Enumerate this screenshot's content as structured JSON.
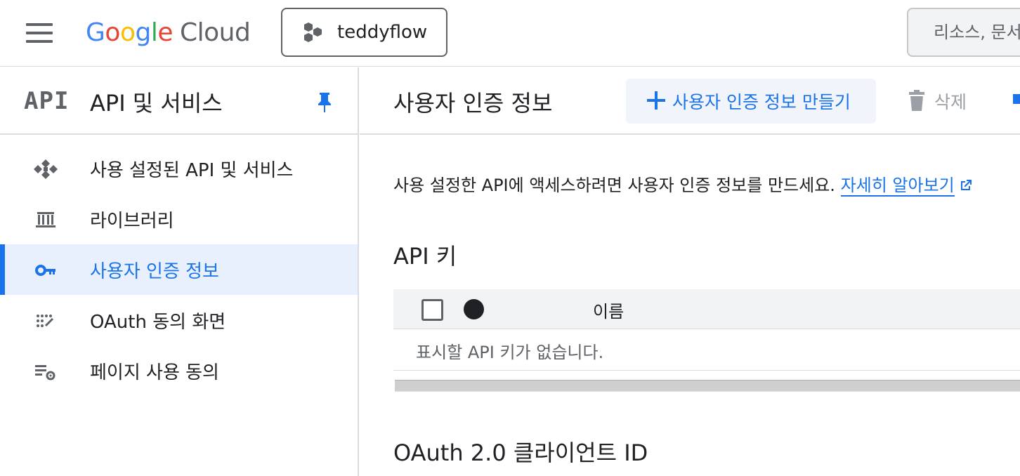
{
  "topbar": {
    "logo_google": [
      "G",
      "o",
      "o",
      "g",
      "l",
      "e"
    ],
    "logo_cloud": "Cloud",
    "project_name": "teddyflow",
    "search_placeholder": "리소스, 문서"
  },
  "sidebar": {
    "logo_text": "API",
    "title": "API 및 서비스",
    "items": [
      {
        "label": "사용 설정된 API 및 서비스",
        "icon": "api-diamond-icon",
        "active": false
      },
      {
        "label": "라이브러리",
        "icon": "library-icon",
        "active": false
      },
      {
        "label": "사용자 인증 정보",
        "icon": "key-icon",
        "active": true
      },
      {
        "label": "OAuth 동의 화면",
        "icon": "oauth-consent-icon",
        "active": false
      },
      {
        "label": "페이지 사용 동의",
        "icon": "page-usage-settings-icon",
        "active": false
      }
    ]
  },
  "main": {
    "title": "사용자 인증 정보",
    "create_button": "사용자 인증 정보 만들기",
    "delete_button": "삭제",
    "description": "사용 설정한 API에 액세스하려면 사용자 인증 정보를 만드세요.",
    "learn_more": "자세히 알아보기",
    "api_keys_title": "API 키",
    "table_col_name": "이름",
    "empty_message": "표시할 API 키가 없습니다.",
    "oauth_title": "OAuth 2.0 클라이언트 ID"
  },
  "colors": {
    "accent": "#1a73e8",
    "active_bg": "#e8f0fe",
    "divider": "#dadce0"
  }
}
